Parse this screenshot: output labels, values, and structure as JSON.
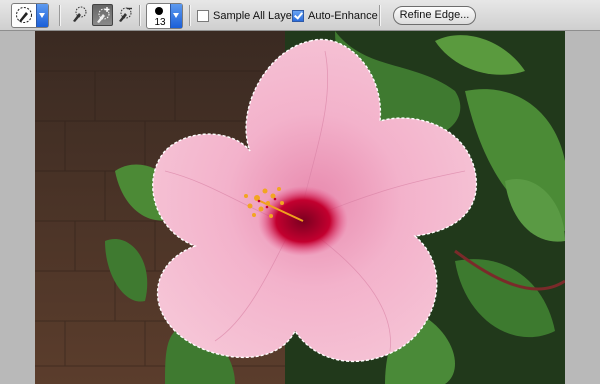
{
  "options_bar": {
    "tool_preset": {
      "icon": "quick-selection-brush-icon"
    },
    "selection_modes": [
      {
        "icon": "new-selection-brush-icon",
        "active": false
      },
      {
        "icon": "add-to-selection-brush-icon",
        "active": true
      },
      {
        "icon": "subtract-from-selection-brush-icon",
        "active": false
      }
    ],
    "brush": {
      "size": "13",
      "icon": "brush-tip-icon"
    },
    "sample_all_layers": {
      "label": "Sample All Layers",
      "checked": false
    },
    "auto_enhance": {
      "label": "Auto-Enhance",
      "checked": true
    },
    "refine_edge_label": "Refine Edge..."
  },
  "annotations": {
    "arrow_color": "#e0201a",
    "arrow_icon": "red-up-arrow-icon"
  },
  "colors": {
    "selection_outline": "#ffffff",
    "petal": "#f2a9c6",
    "flower_center": "#c3002f",
    "background_wall": "#4a3328",
    "leaves": "#3c7a2e"
  },
  "canvas": {
    "image": "pink-hibiscus-flower-photo"
  }
}
